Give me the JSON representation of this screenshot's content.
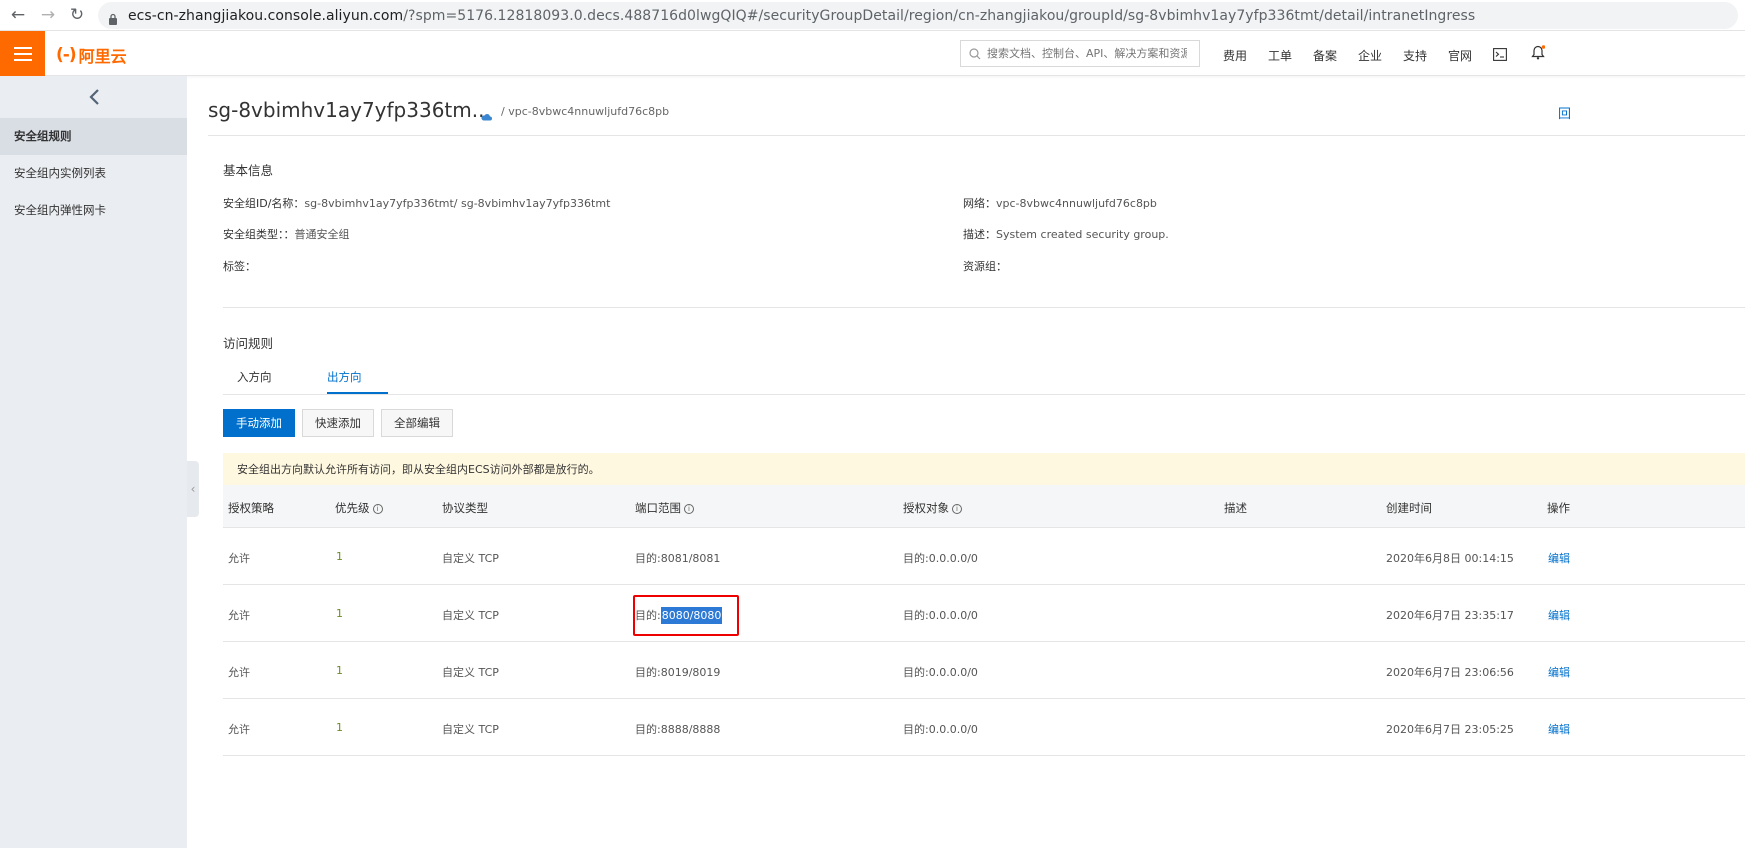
{
  "browser": {
    "url_host": "ecs-cn-zhangjiakou.console.aliyun.com",
    "url_rest": "/?spm=5176.12818093.0.decs.488716d0lwgQIQ#/securityGroupDetail/region/cn-zhangjiakou/groupId/sg-8vbimhv1ay7yfp336tmt/detail/intranetIngress"
  },
  "topbar": {
    "logo_mark": "(-)",
    "logo_text": "阿里云",
    "search_placeholder": "搜索文档、控制台、API、解决方案和资源",
    "nav": [
      "费用",
      "工单",
      "备案",
      "企业",
      "支持",
      "官网"
    ],
    "accent": "#ff6a00"
  },
  "sidebar": {
    "items": [
      {
        "label": "安全组规则"
      },
      {
        "label": "安全组内实例列表"
      },
      {
        "label": "安全组内弹性网卡"
      }
    ]
  },
  "header": {
    "title": "sg-8vbimhv1ay7yfp336tm...",
    "vpc": "/ vpc-8vbwc4nnuwljufd76c8pb",
    "right_text": "回"
  },
  "basic_info": {
    "section_title": "基本信息",
    "id_label": "安全组ID/名称：",
    "id_value": "sg-8vbimhv1ay7yfp336tmt/ sg-8vbimhv1ay7yfp336tmt",
    "type_label": "安全组类型：：",
    "type_value": "普通安全组",
    "tag_label": "标签：",
    "network_label": "网络：",
    "network_value": "vpc-8vbwc4nnuwljufd76c8pb",
    "desc_label": "描述：",
    "desc_value": "System created security group.",
    "rg_label": "资源组："
  },
  "access_rules": {
    "section_title": "访问规则",
    "tabs": [
      "入方向",
      "出方向"
    ],
    "active_tab": "出方向",
    "buttons": {
      "manual_add": "手动添加",
      "quick_add": "快速添加",
      "edit_all": "全部编辑"
    },
    "notice": "安全组出方向默认允许所有访问，即从安全组内ECS访问外部都是放行的。"
  },
  "table": {
    "headers": [
      "授权策略",
      "优先级",
      "协议类型",
      "端口范围",
      "授权对象",
      "描述",
      "创建时间",
      "操作"
    ],
    "info_glyph": "i",
    "rows": [
      {
        "policy": "允许",
        "priority": "1",
        "protocol": "自定义 TCP",
        "port_prefix": "目的:",
        "port_value": "8081/8081",
        "target": "目的:0.0.0.0/0",
        "desc": "",
        "created": "2020年6月8日 00:14:15",
        "action": "编辑"
      },
      {
        "policy": "允许",
        "priority": "1",
        "protocol": "自定义 TCP",
        "port_prefix": "目的:",
        "port_value": "8080/8080",
        "target": "目的:0.0.0.0/0",
        "desc": "",
        "created": "2020年6月7日 23:35:17",
        "action": "编辑"
      },
      {
        "policy": "允许",
        "priority": "1",
        "protocol": "自定义 TCP",
        "port_prefix": "目的:",
        "port_value": "8019/8019",
        "target": "目的:0.0.0.0/0",
        "desc": "",
        "created": "2020年6月7日 23:06:56",
        "action": "编辑"
      },
      {
        "policy": "允许",
        "priority": "1",
        "protocol": "自定义 TCP",
        "port_prefix": "目的:",
        "port_value": "8888/8888",
        "target": "目的:0.0.0.0/0",
        "desc": "",
        "created": "2020年6月7日 23:05:25",
        "action": "编辑"
      }
    ]
  }
}
